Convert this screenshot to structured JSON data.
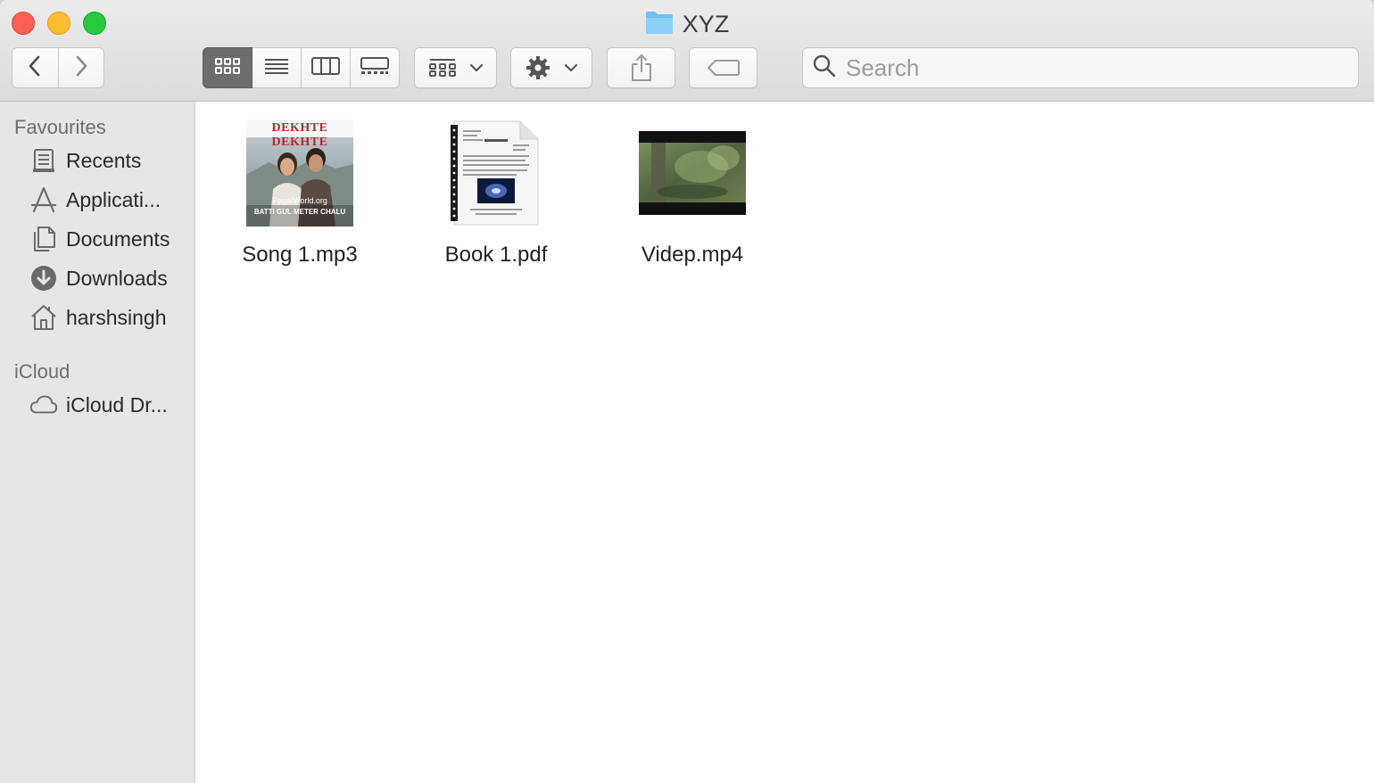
{
  "window": {
    "title": "XYZ"
  },
  "toolbar": {
    "back_icon": "chevron-left-icon",
    "forward_icon": "chevron-right-icon",
    "view_modes": [
      "icon-view",
      "list-view",
      "column-view",
      "gallery-view"
    ],
    "active_view": "icon-view",
    "group_icon": "group-grid-icon",
    "action_icon": "gear-icon",
    "share_icon": "share-icon",
    "tag_icon": "tag-icon"
  },
  "search": {
    "placeholder": "Search",
    "value": ""
  },
  "sidebar": {
    "favourites_title": "Favourites",
    "favourites": [
      {
        "label": "Recents",
        "icon": "recents-icon"
      },
      {
        "label": "Applicati...",
        "icon": "applications-icon"
      },
      {
        "label": "Documents",
        "icon": "documents-icon"
      },
      {
        "label": "Downloads",
        "icon": "downloads-icon"
      },
      {
        "label": "harshsingh",
        "icon": "home-icon"
      }
    ],
    "icloud_title": "iCloud",
    "icloud": [
      {
        "label": "iCloud Dr...",
        "icon": "cloud-icon"
      }
    ]
  },
  "files": [
    {
      "name": "Song 1.mp3",
      "kind": "audio",
      "cover_text": "DEKHTE DEKHTE",
      "cover_sub": "BATTI GUL METER CHALU",
      "cover_watermark": "PagalWorld.org"
    },
    {
      "name": "Book 1.pdf",
      "kind": "pdf"
    },
    {
      "name": "Videp.mp4",
      "kind": "video"
    }
  ],
  "colors": {
    "close": "#fe5f57",
    "minimize": "#febc2e",
    "zoom": "#28c840",
    "sidebar_bg": "#e6e6e6",
    "toolbar_bg": "#e3e3e3",
    "folder": "#6fbff3"
  }
}
